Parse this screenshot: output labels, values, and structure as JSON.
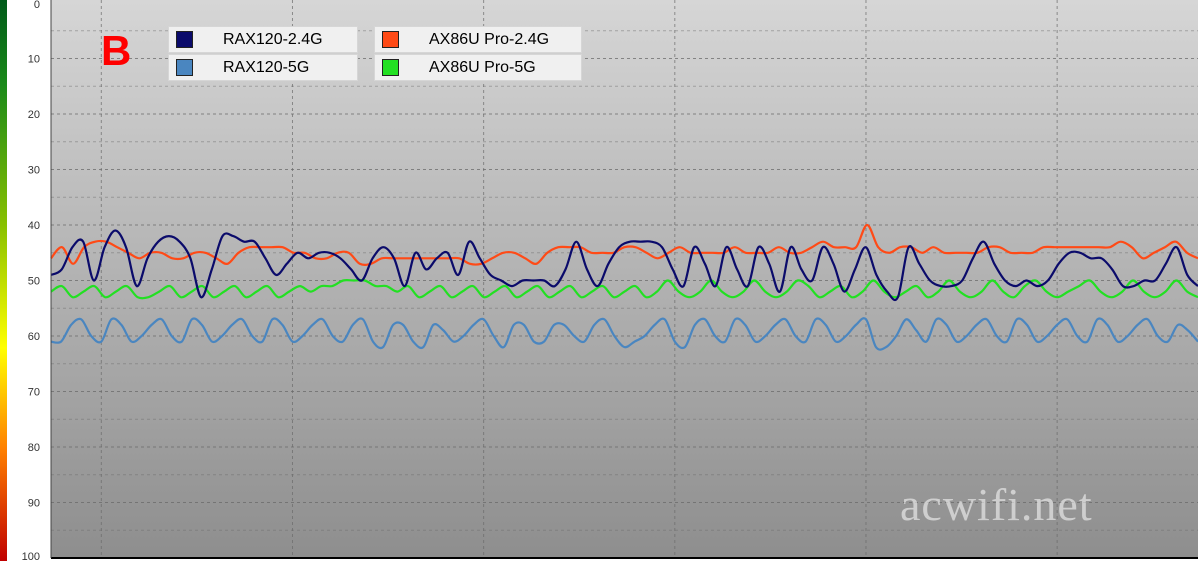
{
  "panel_label": "B",
  "watermark": "acwifi.net",
  "colors": {
    "rax120_24": "#0b0b6b",
    "rax120_5": "#4a86c0",
    "ax86u_24": "#ff4a16",
    "ax86u_5": "#22e022",
    "bg_top": "#d6d6d6",
    "bg_bottom": "#8e8e8e",
    "grid": "#6a6a6a"
  },
  "chart_data": {
    "type": "line",
    "title": "",
    "xlabel": "",
    "ylabel": "",
    "ylim": [
      0,
      100
    ],
    "y_inverted": true,
    "y_ticks": [
      "0",
      "10",
      "20",
      "30",
      "40",
      "50",
      "60",
      "70",
      "80",
      "90",
      "100"
    ],
    "x_range": [
      0,
      114
    ],
    "grid": true,
    "legend_position": "top-left",
    "series": [
      {
        "name": "RAX120-2.4G",
        "color": "#0b0b6b",
        "values": [
          49,
          48,
          44,
          43,
          50,
          44,
          41,
          44,
          51,
          46,
          43,
          42,
          43,
          46,
          53,
          48,
          42,
          42,
          43,
          43,
          46,
          49,
          47,
          45,
          46,
          45,
          45,
          46,
          48,
          50,
          46,
          44,
          46,
          51,
          45,
          48,
          46,
          45,
          49,
          43,
          46,
          49,
          50,
          51,
          50,
          50,
          50,
          51,
          48,
          43,
          48,
          51,
          47,
          44,
          43,
          43,
          43,
          44,
          48,
          51,
          44,
          47,
          51,
          44,
          48,
          51,
          44,
          47,
          52,
          44,
          48,
          50,
          44,
          47,
          52,
          48,
          44,
          49,
          52,
          53,
          44,
          47,
          50,
          51,
          51,
          50,
          46,
          43,
          47,
          50,
          51,
          50,
          51,
          50,
          47,
          45,
          45,
          46,
          46,
          48,
          51,
          51,
          50,
          50,
          47,
          44,
          49,
          51
        ]
      },
      {
        "name": "RAX120-5G",
        "color": "#4a86c0",
        "values": [
          61,
          61,
          58,
          57,
          60,
          61,
          57,
          58,
          61,
          60,
          58,
          57,
          60,
          61,
          57,
          58,
          61,
          60,
          58,
          57,
          60,
          61,
          57,
          58,
          61,
          60,
          58,
          57,
          60,
          61,
          58,
          57,
          61,
          62,
          58,
          58,
          61,
          62,
          58,
          59,
          61,
          60,
          58,
          57,
          60,
          62,
          58,
          58,
          61,
          61,
          58,
          58,
          60,
          61,
          58,
          57,
          60,
          62,
          61,
          60,
          58,
          57,
          61,
          62,
          58,
          57,
          60,
          61,
          57,
          58,
          61,
          60,
          58,
          57,
          60,
          61,
          57,
          58,
          61,
          60,
          58,
          57,
          62,
          62,
          60,
          57,
          59,
          61,
          57,
          58,
          61,
          60,
          58,
          57,
          60,
          61,
          57,
          58,
          61,
          60,
          58,
          57,
          60,
          61,
          57,
          58,
          61,
          60,
          58,
          57,
          60,
          61,
          58,
          59,
          61
        ]
      },
      {
        "name": "AX86U Pro-2.4G",
        "color": "#ff4a16",
        "values": [
          46,
          44,
          47,
          44,
          43,
          43,
          44,
          45,
          46,
          45,
          45,
          46,
          46,
          45,
          45,
          46,
          47,
          45,
          44,
          44,
          44,
          44,
          45,
          45,
          46,
          46,
          45,
          45,
          47,
          47,
          46,
          46,
          46,
          46,
          46,
          46,
          46,
          46,
          47,
          47,
          46,
          45,
          45,
          46,
          47,
          45,
          44,
          44,
          44,
          45,
          45,
          45,
          44,
          44,
          45,
          46,
          45,
          44,
          45,
          45,
          45,
          45,
          44,
          45,
          45,
          45,
          44,
          45,
          45,
          44,
          43,
          44,
          44,
          44,
          40,
          44,
          45,
          44,
          44,
          45,
          44,
          45,
          45,
          45,
          45,
          44,
          44,
          45,
          45,
          45,
          44,
          44,
          44,
          44,
          44,
          44,
          44,
          43,
          44,
          46,
          45,
          44,
          43,
          45,
          46
        ]
      },
      {
        "name": "AX86U Pro-5G",
        "color": "#22e022",
        "values": [
          52,
          51,
          53,
          52,
          51,
          53,
          52,
          51,
          53,
          53,
          52,
          51,
          53,
          52,
          51,
          53,
          52,
          51,
          53,
          52,
          51,
          53,
          52,
          51,
          52,
          51,
          51,
          50,
          50,
          50,
          51,
          51,
          52,
          51,
          53,
          52,
          51,
          53,
          52,
          51,
          53,
          52,
          51,
          53,
          52,
          51,
          53,
          52,
          51,
          53,
          52,
          51,
          53,
          52,
          51,
          53,
          52,
          50,
          52,
          53,
          52,
          50,
          52,
          53,
          52,
          50,
          52,
          53,
          52,
          50,
          51,
          53,
          52,
          51,
          53,
          52,
          50,
          52,
          53,
          52,
          51,
          53,
          52,
          50,
          52,
          53,
          52,
          50,
          52,
          53,
          51,
          50,
          52,
          53,
          52,
          51,
          50,
          52,
          53,
          52,
          50,
          52,
          53,
          52,
          50,
          52,
          53
        ]
      }
    ]
  }
}
